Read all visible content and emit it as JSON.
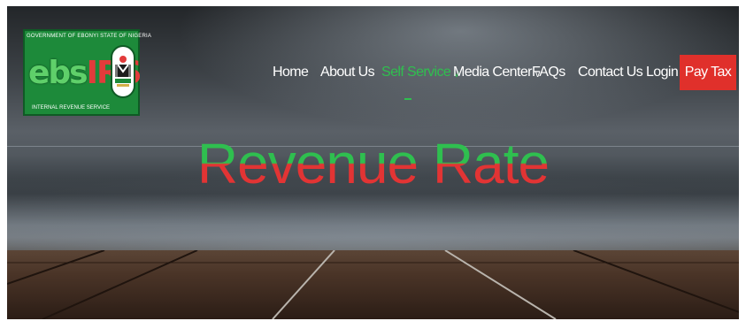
{
  "logo": {
    "top_text": "GOVERNMENT OF EBONYI STATE OF NIGERIA",
    "main_green": "ebs",
    "main_red": "IRS",
    "bottom_text": "INTERNAL REVENUE SERVICE",
    "seal_icon": "coat-of-arms-icon"
  },
  "nav": {
    "items": [
      {
        "label": "Home"
      },
      {
        "label": "About Us"
      },
      {
        "label": "Self Service",
        "active": true,
        "dropdown": true
      },
      {
        "label": "Media Center",
        "dropdown": true
      },
      {
        "label": "FAQs"
      },
      {
        "label": "Contact Us"
      },
      {
        "label": "Login"
      }
    ],
    "dropdown_glyph": "v",
    "pay_button": "Pay Tax"
  },
  "hero": {
    "title": "Revenue Rate"
  },
  "colors": {
    "accent_green": "#2fbf4f",
    "accent_red": "#e0302b",
    "logo_green": "#1d8a3a"
  }
}
